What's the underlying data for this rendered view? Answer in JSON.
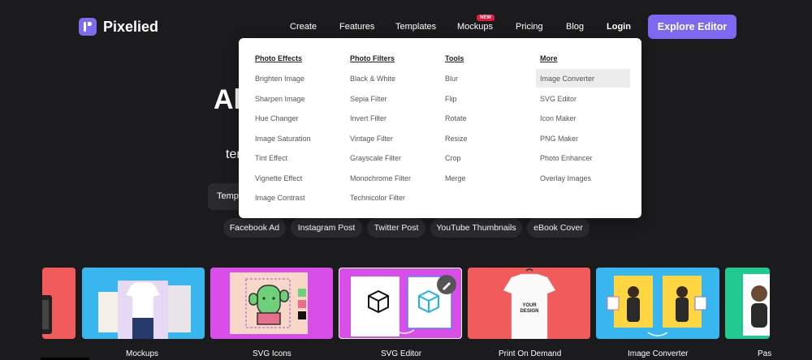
{
  "brand": {
    "name": "Pixelied"
  },
  "nav": {
    "create": "Create",
    "features": "Features",
    "templates": "Templates",
    "mockups": "Mockups",
    "new_badge": "NEW",
    "pricing": "Pricing",
    "blog": "Blog",
    "login": "Login",
    "explore_button": "Explore Editor"
  },
  "hero": {
    "title_partial": "Al",
    "subtitle_partial": "ter",
    "search_partial": "Templ"
  },
  "quick_chips": [
    "Facebook Ad",
    "Instagram Post",
    "Twitter Post",
    "YouTube Thumbnails",
    "eBook Cover"
  ],
  "dropdown": {
    "columns": [
      {
        "heading": "Photo Effects",
        "items": [
          "Brighten Image",
          "Sharpen Image",
          "Hue Changer",
          "Image Saturation",
          "Tint Effect",
          "Vignette Effect",
          "Image Contrast"
        ]
      },
      {
        "heading": "Photo Filters",
        "items": [
          "Black & White",
          "Sepia Filter",
          "Invert Filter",
          "Vintage Filter",
          "Grayscale Filter",
          "Monochrome Filter",
          "Technicolor Filter"
        ]
      },
      {
        "heading": "Tools",
        "items": [
          "Blur",
          "Flip",
          "Rotate",
          "Resize",
          "Crop",
          "Merge"
        ]
      },
      {
        "heading": "More",
        "items": [
          "Image Converter",
          "SVG Editor",
          "Icon Maker",
          "PNG Maker",
          "Photo Enhancer",
          "Overlay Images"
        ]
      }
    ],
    "highlighted_item": "Image Converter"
  },
  "carousel": {
    "labels": [
      "Mockups",
      "SVG Icons",
      "SVG Editor",
      "Print On Demand",
      "Image Converter",
      "Pas"
    ],
    "colors": {
      "first_partial": "#f25b5b",
      "mockups": "#38b6f0",
      "svg_icons": "#d94ee8",
      "svg_editor": "#d94ee8",
      "print_on_demand": "#f25b5b",
      "image_converter": "#38b6f0",
      "last_partial": "#1fc98f"
    },
    "tshirt_text": [
      "YOUR",
      "DESIGN"
    ]
  },
  "colors": {
    "accent": "#7d68f2",
    "background": "#1b1b1d",
    "badge": "#e8193c"
  }
}
